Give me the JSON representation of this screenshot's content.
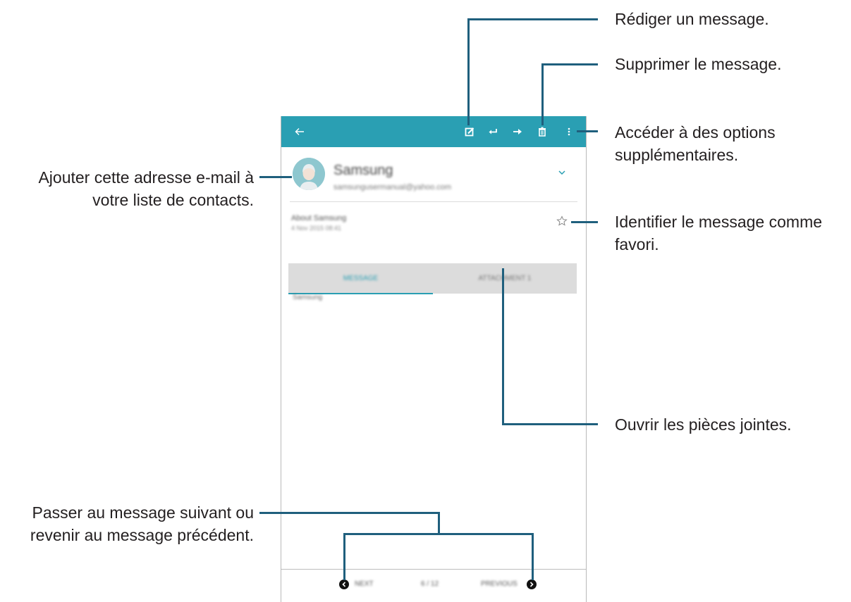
{
  "callouts": {
    "compose": "Rédiger un message.",
    "delete": "Supprimer le message.",
    "options_line1": "Accéder à des options",
    "options_line2": "supplémentaires.",
    "add_contact_line1": "Ajouter cette adresse e-mail à",
    "add_contact_line2": "votre liste de contacts.",
    "favorite_line1": "Identifier le message comme",
    "favorite_line2": "favori.",
    "attachments": "Ouvrir les pièces jointes.",
    "navigate_line1": "Passer au message suivant ou",
    "navigate_line2": "revenir au message précédent."
  },
  "colors": {
    "app_bar": "#2a9fb3",
    "callout_line": "#1f5f7d",
    "tab_bar": "#dcdcdc"
  },
  "app_bar": {
    "icons": [
      "back-arrow-icon",
      "compose-icon",
      "reply-icon",
      "forward-icon",
      "delete-icon",
      "more-options-icon"
    ]
  },
  "email": {
    "sender_name": "Samsung",
    "sender_email": "samsungusermanual@yahoo.com",
    "subject": "About Samsung",
    "date": "4 Nov 2015 08:41",
    "body": "Samsung"
  },
  "tabs": {
    "message": "MESSAGE",
    "attachment": "ATTACHMENT 1"
  },
  "navigation": {
    "next": "NEXT",
    "counter": "6 / 12",
    "previous": "PREVIOUS"
  }
}
